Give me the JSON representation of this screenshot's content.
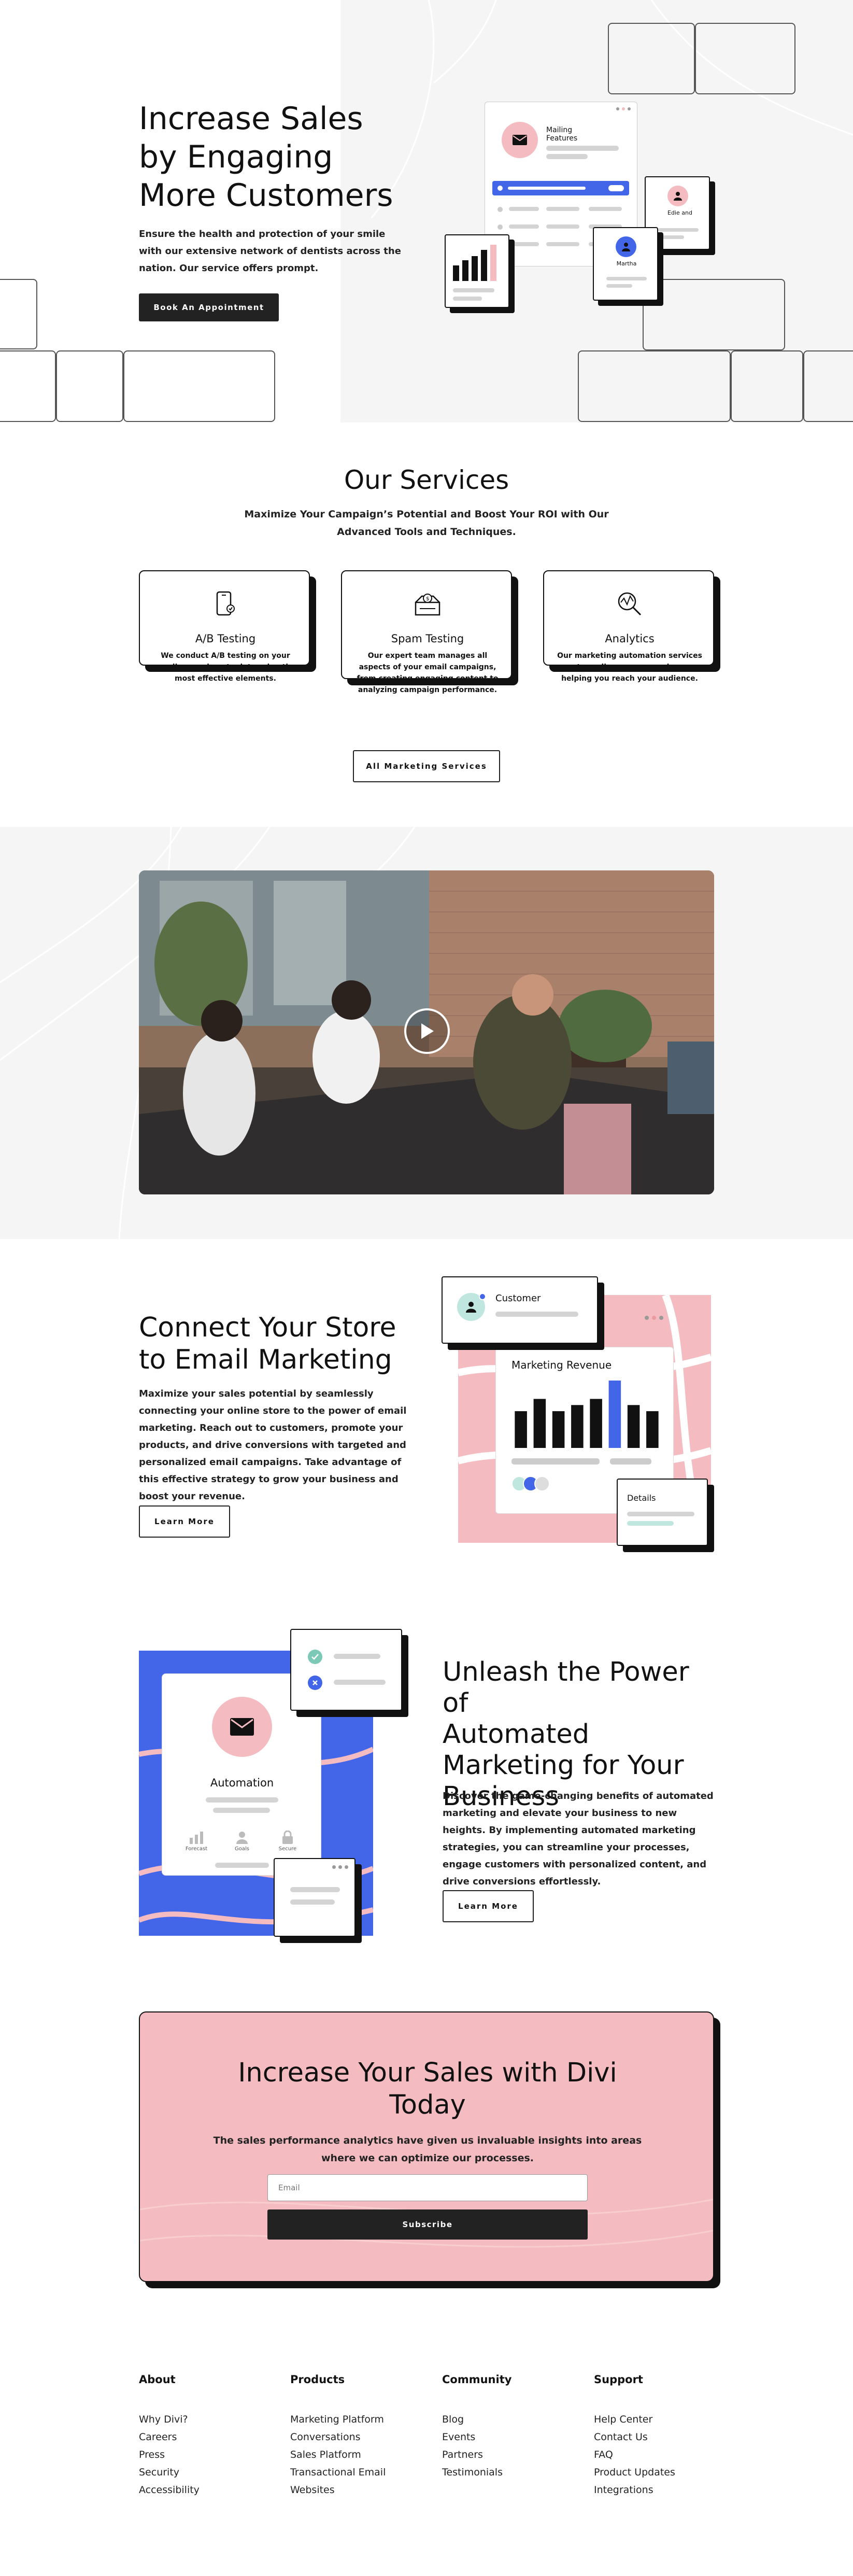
{
  "hero": {
    "title_line1": "Increase Sales",
    "title_line2": "by Engaging",
    "title_line3": "More Customers",
    "body": "Ensure the health and protection of your smile with our extensive network of dentists across the nation. Our service offers prompt.",
    "cta_label": "Book An Appointment",
    "mock_card_label": "Mailing Features",
    "profile_name": "Edie and",
    "profile_name2": "Martha"
  },
  "services": {
    "title": "Our Services",
    "subtitle": "Maximize Your Campaign’s Potential and Boost Your ROI with Our Advanced Tools and Techniques.",
    "cards": [
      {
        "title": "A/B Testing",
        "text": "We conduct A/B testing on your email campaigns to determine the most effective elements.",
        "icon": "phone-icon"
      },
      {
        "title": "Spam Testing",
        "text": "Our expert team manages all aspects of your email campaigns, from creating engaging content to analyzing campaign performance.",
        "icon": "mailbox-icon"
      },
      {
        "title": "Analytics",
        "text": "Our marketing automation services streamline your campaigns, helping you reach your audience.",
        "icon": "analytics-search-icon"
      }
    ],
    "cta_label": "All Marketing Services"
  },
  "video": {
    "play_icon": "play-icon"
  },
  "connect": {
    "title_line1": "Connect Your Store",
    "title_line2": "to Email Marketing",
    "body": "Maximize your sales potential by seamlessly connecting your online store to the power of email marketing. Reach out to customers, promote your products, and drive conversions with targeted and personalized email campaigns. Take advantage of this effective strategy to grow your business and boost your revenue.",
    "cta_label": "Learn More",
    "customer_label": "Customer",
    "revenue_label": "Marketing Revenue",
    "details_label": "Details",
    "revenue_values": [
      3,
      4,
      3,
      3.5,
      4,
      5.5,
      3.5,
      3
    ],
    "highlight_index": 5
  },
  "automation": {
    "title_line1": "Unleash the Power of",
    "title_line2": "Automated",
    "title_line3": "Marketing for Your",
    "title_line4": "Business",
    "body": "Discover the game-changing benefits of automated marketing and elevate your business to new heights. By implementing automated marketing strategies, you can streamline your processes, engage customers with personalized content, and drive conversions effortlessly.",
    "cta_label": "Learn More",
    "card_label": "Automation",
    "stat1": "Forecast",
    "stat2": "Goals",
    "stat3": "Secure"
  },
  "cta_section": {
    "title_line1": "Increase Your Sales with Divi",
    "title_line2": "Today",
    "body": "The sales performance analytics have given us invaluable insights into areas where we can optimize our processes.",
    "email_placeholder": "Email",
    "subscribe_label": "Subscribe"
  },
  "footer": {
    "columns": [
      {
        "title": "About",
        "links": [
          "Why Divi?",
          "Careers",
          "Press",
          "Security",
          "Accessibility"
        ]
      },
      {
        "title": "Products",
        "links": [
          "Marketing Platform",
          "Conversations",
          "Sales Platform",
          "Transactional Email",
          "Websites"
        ]
      },
      {
        "title": "Community",
        "links": [
          "Blog",
          "Events",
          "Partners",
          "Testimonials"
        ]
      },
      {
        "title": "Support",
        "links": [
          "Help Center",
          "Contact Us",
          "FAQ",
          "Product Updates",
          "Integrations"
        ]
      }
    ]
  },
  "colors": {
    "pink": "#f4bcc0",
    "blue": "#4366e8",
    "dark": "#222222",
    "mint": "#bfe7df",
    "light_gray": "#f5f5f5"
  }
}
